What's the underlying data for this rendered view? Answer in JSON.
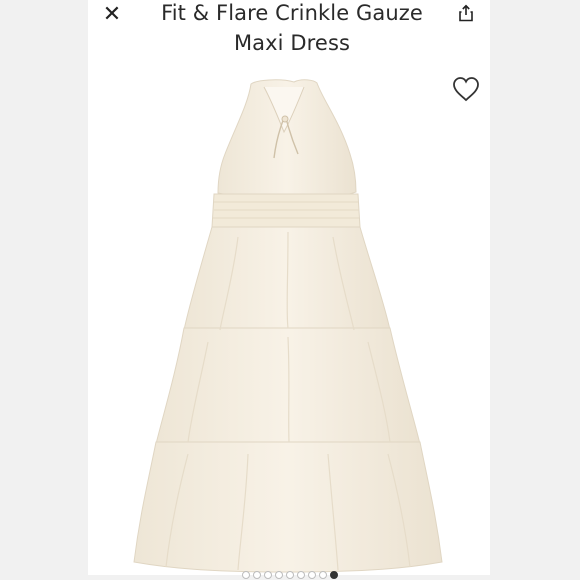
{
  "header": {
    "title": "Fit & Flare Crinkle Gauze Maxi Dress",
    "close_icon": "close-icon",
    "share_icon": "share-icon"
  },
  "product": {
    "favorite_icon": "heart-outline-icon",
    "dress_color": "#f6efe2"
  },
  "carousel": {
    "count": 9,
    "active_index": 8
  }
}
